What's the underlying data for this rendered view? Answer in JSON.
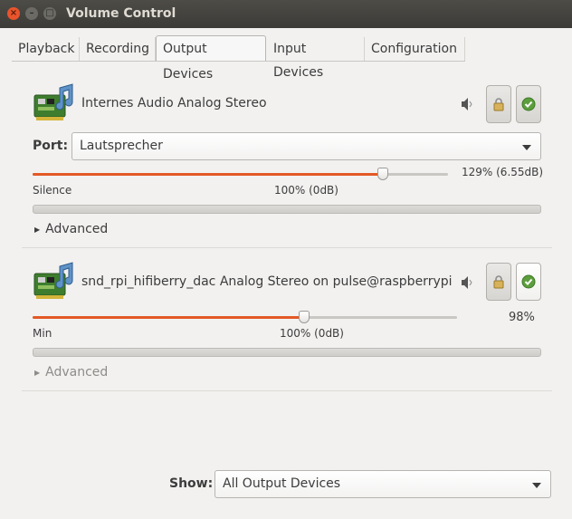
{
  "window": {
    "title": "Volume Control",
    "close_glyph": "×",
    "min_glyph": "–",
    "max_glyph": "□"
  },
  "tabs": [
    {
      "label": "Playback"
    },
    {
      "label": "Recording"
    },
    {
      "label": "Output Devices",
      "active": true
    },
    {
      "label": "Input Devices"
    },
    {
      "label": "Configuration"
    }
  ],
  "devices": [
    {
      "name": "Internes Audio Analog Stereo",
      "icon": "sound-card-icon",
      "port_label": "Port:",
      "port_value": "Lautsprecher",
      "volume_percent": 129,
      "value_text": "129% (6.55dB)",
      "min_label": "Silence",
      "base_label": "100% (0dB)",
      "advanced_label": "Advanced",
      "locked": true,
      "default": true
    },
    {
      "name": "snd_rpi_hifiberry_dac Analog Stereo on pulse@raspberrypi",
      "icon": "sound-card-icon",
      "volume_percent": 98,
      "value_text": "98%",
      "min_label": "Min",
      "base_label": "100% (0dB)",
      "advanced_label": "Advanced",
      "locked": true,
      "default": true
    }
  ],
  "footer": {
    "show_label": "Show:",
    "show_value": "All Output Devices"
  },
  "colors": {
    "accent": "#e35925",
    "titlebar": "#3c3b37",
    "close_button": "#e9542c",
    "default_check": "#5c9e3d"
  }
}
